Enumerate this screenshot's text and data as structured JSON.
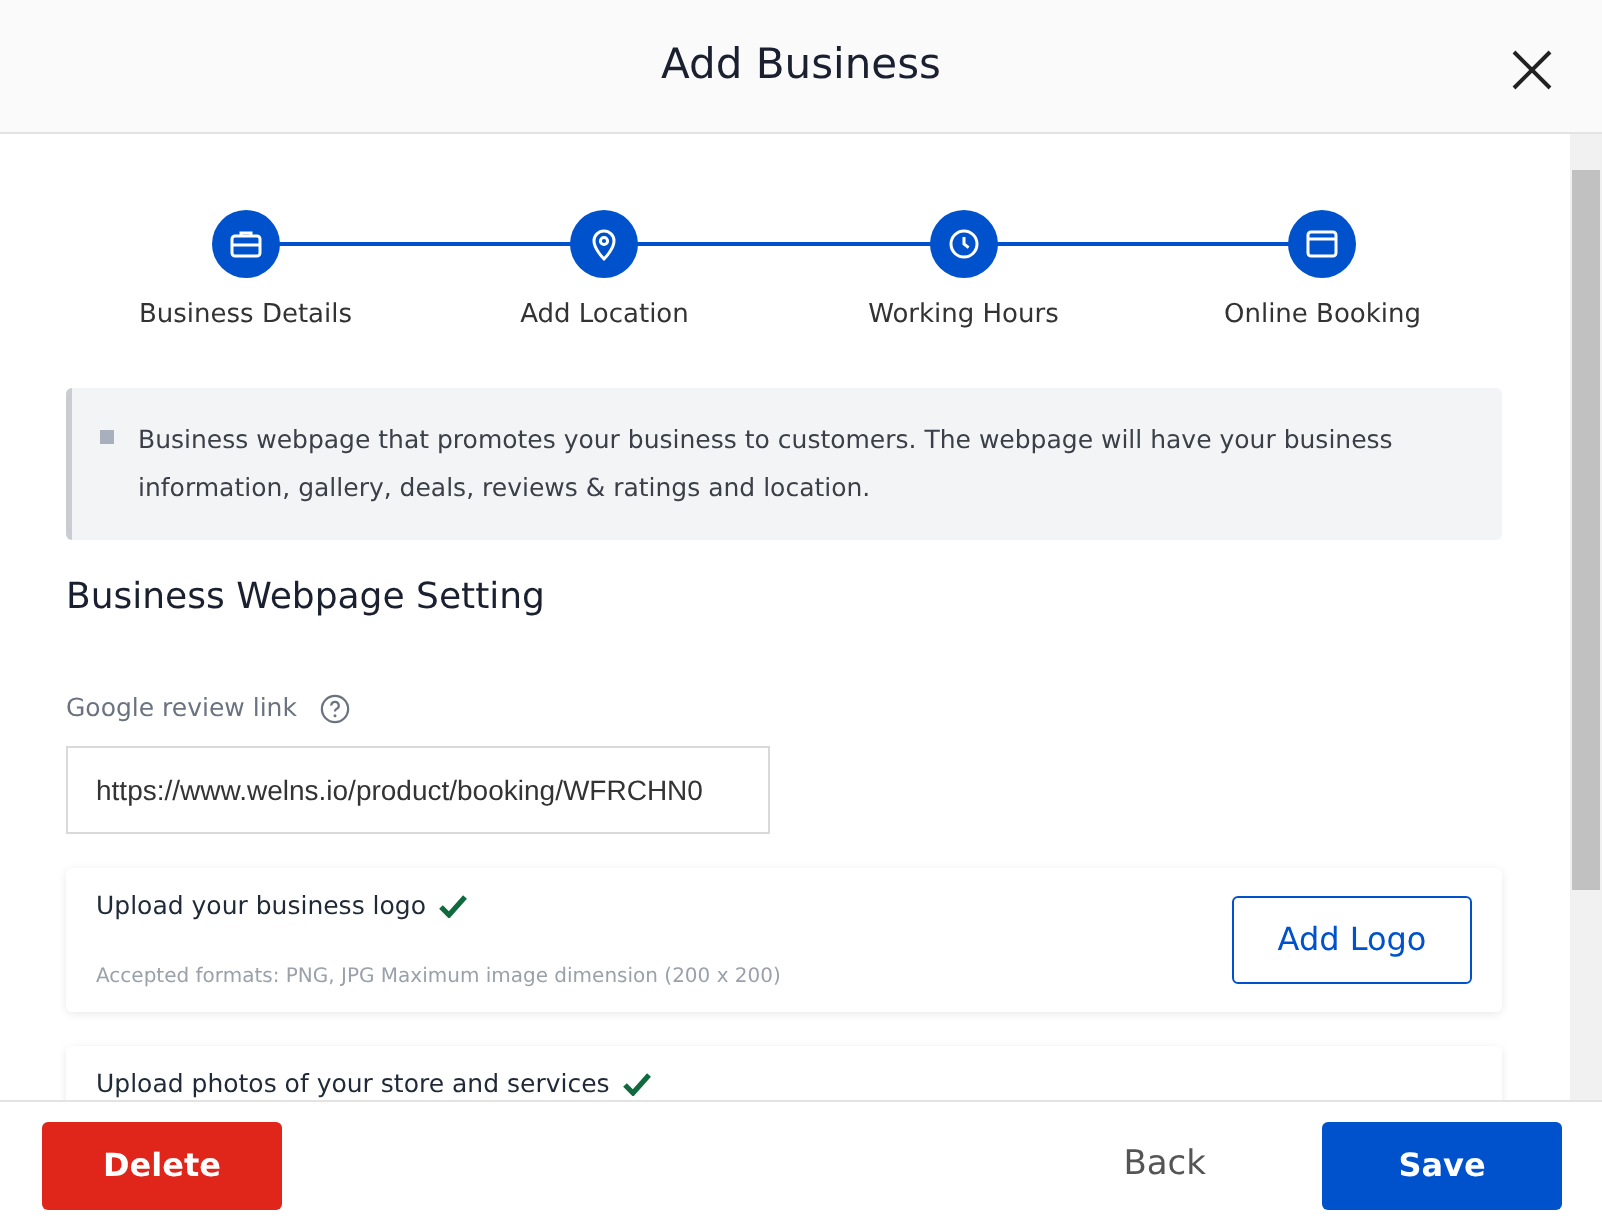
{
  "dialog": {
    "title": "Add Business"
  },
  "steps": [
    {
      "label": "Business Details",
      "kind": "briefcase"
    },
    {
      "label": "Add Location",
      "kind": "pin"
    },
    {
      "label": "Working Hours",
      "kind": "clock"
    },
    {
      "label": "Online Booking",
      "kind": "window"
    }
  ],
  "info": "Business webpage that promotes your business to customers. The webpage will have your business information, gallery, deals, reviews & ratings and location.",
  "section_title": "Business Webpage Setting",
  "review_link": {
    "label": "Google review link",
    "value": "https://www.welns.io/product/booking/WFRCHN0"
  },
  "uploads": [
    {
      "title": "Upload your business logo",
      "done": true,
      "note": "Accepted formats: PNG, JPG Maximum image dimension (200 x 200)",
      "button": "Add Logo"
    },
    {
      "title": "Upload photos of your store and services",
      "done": true
    }
  ],
  "footer": {
    "delete": "Delete",
    "back": "Back",
    "save": "Save"
  }
}
